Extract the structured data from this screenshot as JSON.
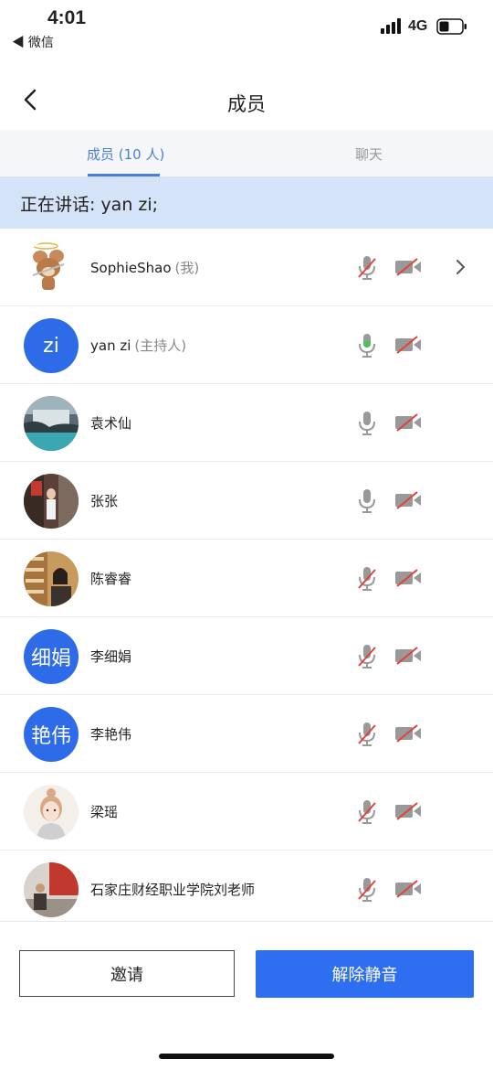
{
  "status": {
    "time": "4:01",
    "back_app": "◀ 微信",
    "network": "4G"
  },
  "nav": {
    "title": "成员"
  },
  "tabs": [
    {
      "label": "成员 (10 人)",
      "active": true
    },
    {
      "label": "聊天",
      "active": false
    }
  ],
  "speaking": "正在讲话: yan zi;",
  "members": [
    {
      "name": "SophieShao",
      "role": "(我)",
      "avatar_type": "image",
      "avatar_desc": "cartoon-mouse",
      "mic": "muted",
      "camera": "off",
      "has_chevron": true
    },
    {
      "name": "yan zi",
      "role": "(主持人)",
      "avatar_type": "text",
      "avatar_text": "zi",
      "mic": "speaking",
      "camera": "off"
    },
    {
      "name": "袁术仙",
      "role": "",
      "avatar_type": "image",
      "avatar_desc": "waterfall-landscape",
      "mic": "on",
      "camera": "off"
    },
    {
      "name": "张张",
      "role": "",
      "avatar_type": "image",
      "avatar_desc": "street-photo",
      "mic": "on",
      "camera": "off"
    },
    {
      "name": "陈睿睿",
      "role": "",
      "avatar_type": "image",
      "avatar_desc": "woman-bookshelf",
      "mic": "muted",
      "camera": "off"
    },
    {
      "name": "李细娟",
      "role": "",
      "avatar_type": "text",
      "avatar_text": "细娟",
      "mic": "muted",
      "camera": "off"
    },
    {
      "name": "李艳伟",
      "role": "",
      "avatar_type": "text",
      "avatar_text": "艳伟",
      "mic": "muted",
      "camera": "off"
    },
    {
      "name": "梁瑶",
      "role": "",
      "avatar_type": "image",
      "avatar_desc": "illustrated-girl",
      "mic": "muted",
      "camera": "off"
    },
    {
      "name": "石家庄财经职业学院刘老师",
      "role": "",
      "avatar_type": "image",
      "avatar_desc": "man-outdoor",
      "mic": "muted",
      "camera": "off"
    }
  ],
  "footer": {
    "invite": "邀请",
    "unmute": "解除静音"
  },
  "colors": {
    "accent": "#2e6ef0",
    "speaking_bg": "#d4e3f7",
    "muted_red": "#e0423a",
    "mic_green": "#4cc05a"
  }
}
